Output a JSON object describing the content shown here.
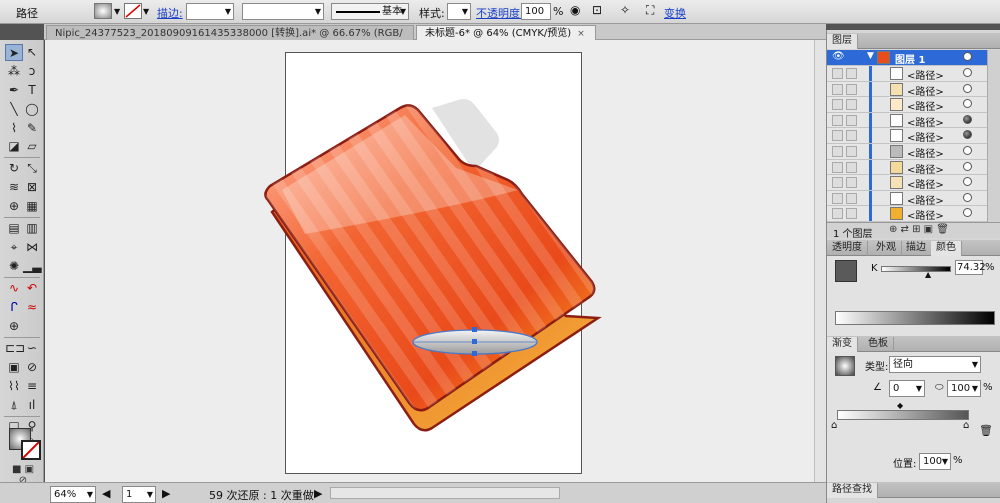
{
  "control_bar": {
    "selection_label": "路径",
    "stroke_label": "描边:",
    "stroke_style": "基本",
    "style_label": "样式:",
    "opacity_label": "不透明度:",
    "opacity_value": "100",
    "opacity_unit": "%",
    "transform_label": "变换"
  },
  "tabs": [
    {
      "label": "Nipic_24377523_20180909161435338000 [转换].ai* @ 66.67% (RGB/预览)",
      "close": "×"
    },
    {
      "label": "未标题-6* @ 64% (CMYK/预览)",
      "close": "×"
    }
  ],
  "status_bar": {
    "zoom": "64%",
    "page": "1",
    "history": "59 次还原 : 1 次重做"
  },
  "layers_panel": {
    "title": "图层",
    "layer_name": "图层 1",
    "paths": [
      "<路径>",
      "<路径>",
      "<路径>",
      "<路径>",
      "<路径>",
      "<路径>",
      "<路径>",
      "<路径>",
      "<路径>",
      "<路径>"
    ],
    "filled_targets": [
      3,
      4
    ],
    "footer_count": "1 个图层"
  },
  "color_panel": {
    "tabs": [
      "透明度",
      "外观",
      "描边",
      "颜色"
    ],
    "channel": "K",
    "value": "74.32",
    "unit": "%"
  },
  "gradient_panel": {
    "tabs": [
      "渐变",
      "色板"
    ],
    "type_label": "类型:",
    "type_value": "径向",
    "angle_value": "0",
    "aspect_value": "100",
    "aspect_unit": "%",
    "location_label": "位置:",
    "location_value": "100",
    "location_unit": "%"
  },
  "bottom_panel": {
    "label": "路径查找"
  },
  "colors": {
    "accent_blue": "#2d6ad8",
    "folder_orange": "#e84e1b",
    "folder_outline": "#8c1d12"
  }
}
